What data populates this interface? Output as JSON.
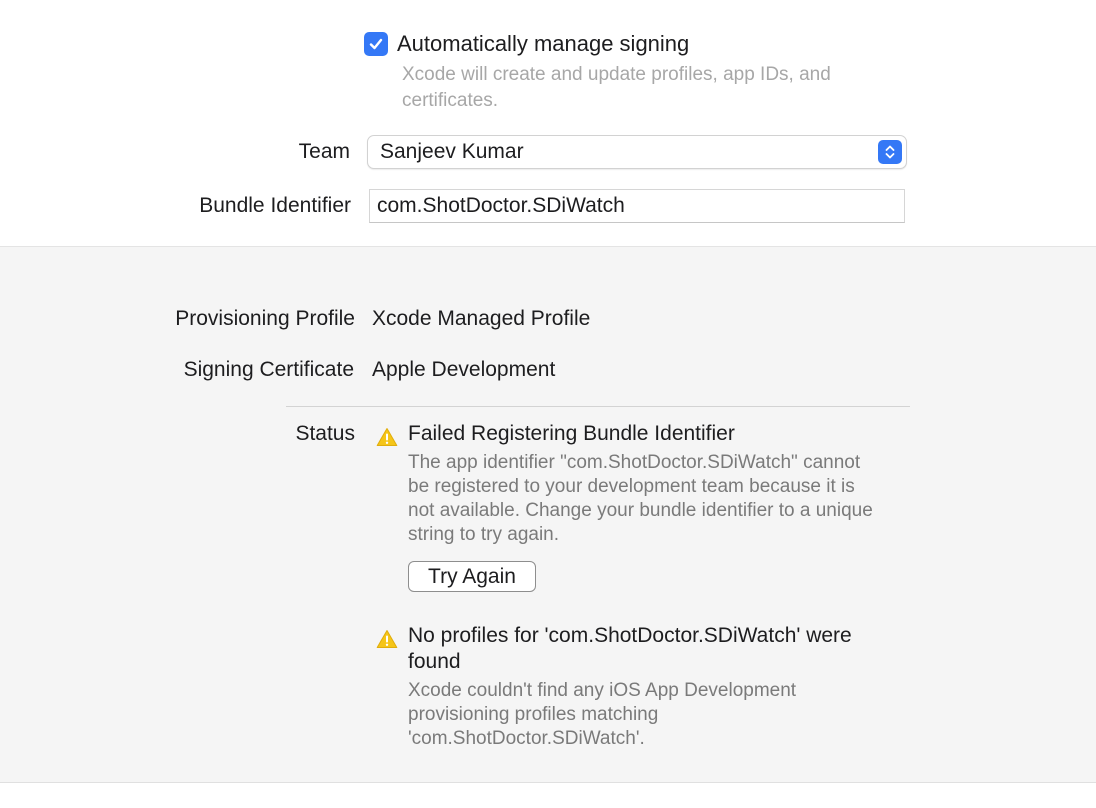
{
  "signing": {
    "auto_manage_label": "Automatically manage signing",
    "auto_manage_checked": true,
    "auto_manage_description": "Xcode will create and update profiles, app IDs, and certificates.",
    "team_label": "Team",
    "team_value": "Sanjeev Kumar",
    "bundle_label": "Bundle Identifier",
    "bundle_value": "com.ShotDoctor.SDiWatch"
  },
  "details": {
    "provisioning_label": "Provisioning Profile",
    "provisioning_value": "Xcode Managed Profile",
    "certificate_label": "Signing Certificate",
    "certificate_value": "Apple Development",
    "status_label": "Status",
    "issues": [
      {
        "icon": "warning-icon",
        "title": "Failed Registering Bundle Identifier",
        "description": "The app identifier \"com.ShotDoctor.SDiWatch\" cannot be registered to your development team because it is not available. Change your bundle identifier to a unique string to try again.",
        "button_label": "Try Again"
      },
      {
        "icon": "warning-icon",
        "title": "No profiles for 'com.ShotDoctor.SDiWatch' were found",
        "description": "Xcode couldn't find any iOS App Development provisioning profiles matching 'com.ShotDoctor.SDiWatch'."
      }
    ]
  },
  "colors": {
    "accent": "#3478f6",
    "warning": "#f5c518",
    "secondary_text": "#7a7a7a",
    "panel_background": "#f5f5f5"
  }
}
